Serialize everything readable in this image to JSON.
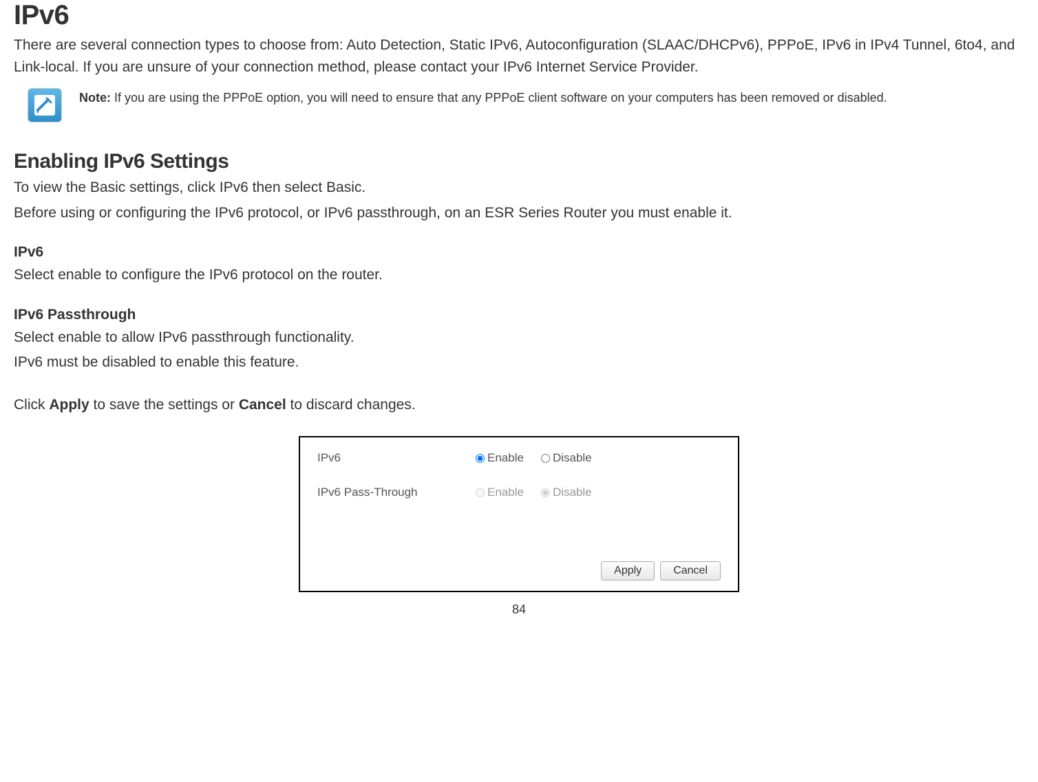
{
  "title": "IPv6",
  "intro": "There are several connection types to choose from: Auto Detection, Static IPv6, Autoconfiguration (SLAAC/DHCPv6), PPPoE, IPv6 in IPv4 Tunnel, 6to4, and Link-local. If you are unsure of your connection method, please contact your IPv6 Internet Service Provider.",
  "note": {
    "label": "Note:",
    "text": " If you are using the PPPoE option, you will need to ensure that any PPPoE client software on your computers has been removed or disabled."
  },
  "section": {
    "heading": "Enabling IPv6 Settings",
    "p1": "To view the Basic settings, click IPv6 then select Basic.",
    "p2": "Before using or configuring the IPv6 protocol, or IPv6 passthrough, on an ESR Series Router you must enable it."
  },
  "ipv6": {
    "heading": "IPv6",
    "text": "Select enable to configure the IPv6 protocol on the router."
  },
  "passthrough": {
    "heading": "IPv6 Passthrough",
    "p1": "Select enable to allow IPv6 passthrough functionality.",
    "p2": "IPv6 must be disabled to enable this feature."
  },
  "action": {
    "prefix": "Click ",
    "apply": "Apply",
    "mid": " to save the settings or ",
    "cancel": "Cancel",
    "suffix": " to discard changes."
  },
  "panel": {
    "row1_label": "IPv6",
    "row2_label": "IPv6 Pass-Through",
    "enable": "Enable",
    "disable": "Disable",
    "apply_btn": "Apply",
    "cancel_btn": "Cancel"
  },
  "page_number": "84"
}
